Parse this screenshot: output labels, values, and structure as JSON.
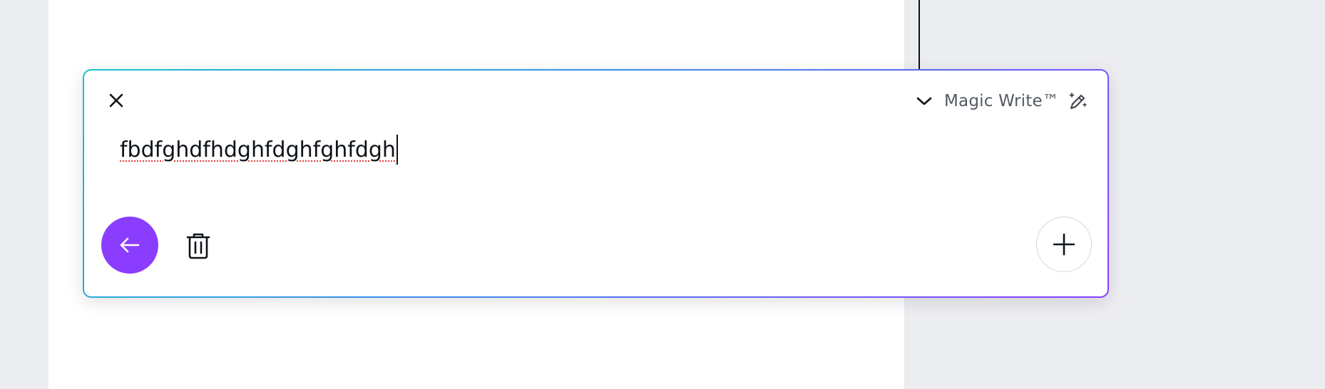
{
  "panel": {
    "title": "Magic Write™",
    "prompt_value": "fbdfghdfhdghfdghfghfdgh"
  },
  "icons": {
    "close": "close-icon",
    "collapse": "chevron-down-icon",
    "magic": "magic-pen-icon",
    "submit": "arrow-left-icon",
    "delete": "trash-icon",
    "add": "plus-icon"
  },
  "colors": {
    "accent": "#8b3dff",
    "gradient_start": "#17c3c9",
    "gradient_end": "#8b3dff",
    "spellcheck": "#e23b3b",
    "workspace_background": "#ecedf1"
  }
}
